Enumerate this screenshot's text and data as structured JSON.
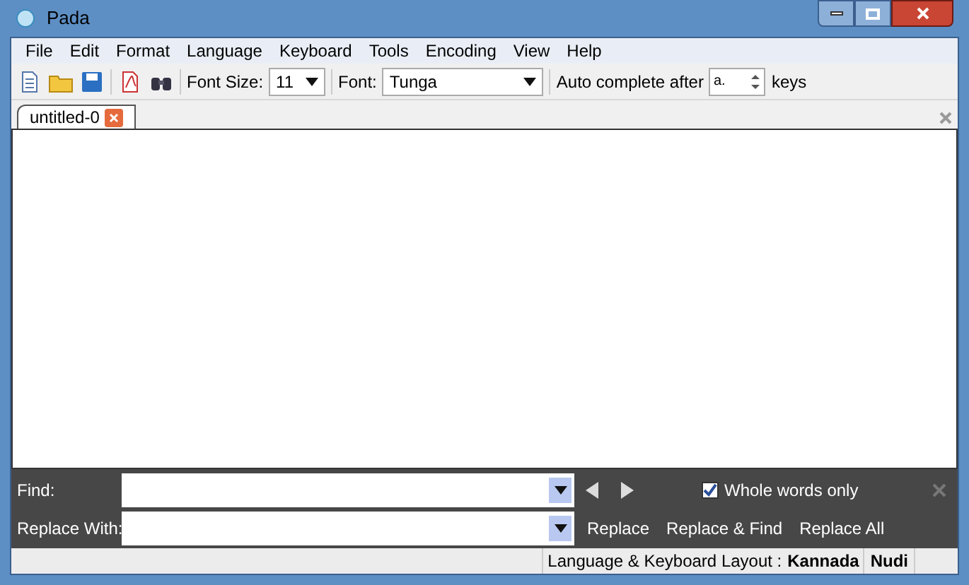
{
  "window": {
    "title": "Pada"
  },
  "menu": [
    "File",
    "Edit",
    "Format",
    "Language",
    "Keyboard",
    "Tools",
    "Encoding",
    "View",
    "Help"
  ],
  "toolbar": {
    "font_size_label": "Font Size:",
    "font_size": "11",
    "font_label": "Font:",
    "font": "Tunga",
    "autocomplete_label": "Auto complete after",
    "autocomplete_value": "a.",
    "keys_label": "keys"
  },
  "tabs": [
    {
      "label": "untitled-0",
      "selected": true
    }
  ],
  "find_panel": {
    "find_label": "Find:",
    "replace_label": "Replace With:",
    "whole_words": {
      "label": "Whole words only",
      "checked": true
    },
    "buttons": [
      "Replace",
      "Replace & Find",
      "Replace All"
    ]
  },
  "status_bar": {
    "label": "Language & Keyboard Layout :",
    "language": "Kannada",
    "layout": "Nudi"
  }
}
